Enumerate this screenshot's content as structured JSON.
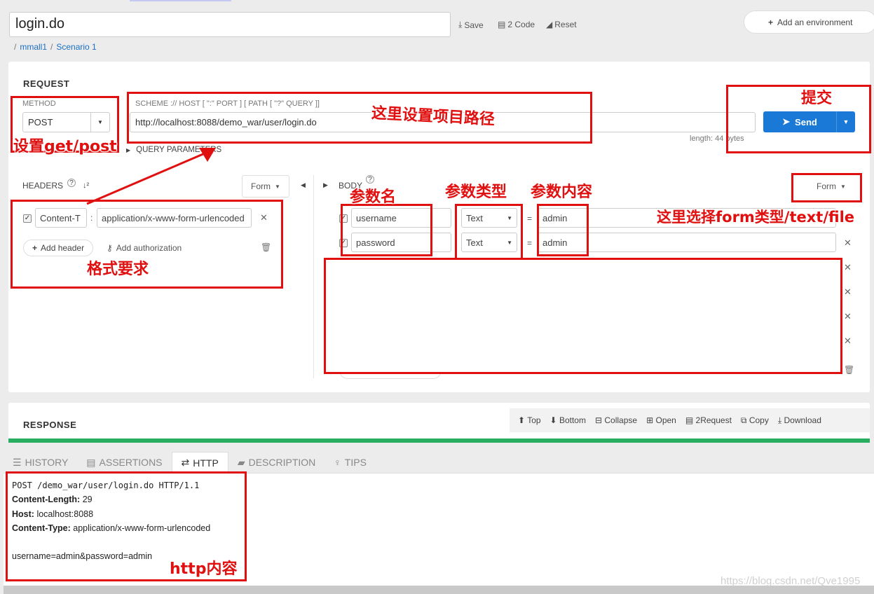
{
  "title": "login.do",
  "toolbar": {
    "save": "Save",
    "code": "2 Code",
    "reset": "Reset",
    "add_env": "Add an environment"
  },
  "breadcrumbs": [
    "mmall1",
    "Scenario 1"
  ],
  "request": {
    "heading": "REQUEST",
    "method_label": "METHOD",
    "method_value": "POST",
    "scheme_hint": "SCHEME :// HOST [ \":\" PORT ] [ PATH [ \"?\" QUERY ]]",
    "url": "http://localhost:8088/demo_war/user/login.do",
    "length": "length: 44 bytes",
    "query_params": "QUERY PARAMETERS",
    "send": "Send"
  },
  "headers": {
    "label": "HEADERS",
    "mode": "Form",
    "row": {
      "name": "Content-T",
      "value": "application/x-www-form-urlencoded"
    },
    "add_header": "Add header",
    "add_auth": "Add authorization"
  },
  "body": {
    "label": "BODY",
    "mode": "Form",
    "params": [
      {
        "name": "username",
        "type": "Text",
        "value": "admin"
      },
      {
        "name": "password",
        "type": "Text",
        "value": "admin"
      }
    ]
  },
  "response": {
    "heading": "RESPONSE",
    "tools": [
      "Top",
      "Bottom",
      "Collapse",
      "Open",
      "2Request",
      "Copy",
      "Download"
    ]
  },
  "tabs": [
    "HISTORY",
    "ASSERTIONS",
    "HTTP",
    "DESCRIPTION",
    "TIPS"
  ],
  "active_tab": "HTTP",
  "http": {
    "request_line": "POST /demo_war/user/login.do HTTP/1.1",
    "headers": [
      {
        "key": "Content-Length:",
        "value": "29"
      },
      {
        "key": "Host:",
        "value": "localhost:8088"
      },
      {
        "key": "Content-Type:",
        "value": "application/x-www-form-urlencoded"
      }
    ],
    "body": "username=admin&password=admin"
  },
  "annotations": {
    "submit": "提交",
    "path": "这里设置项目路径",
    "method": "设置get/post",
    "format": "格式要求",
    "param_name": "参数名",
    "param_type": "参数类型",
    "param_value": "参数内容",
    "form_type": "这里选择form类型/text/file",
    "http_content": "http内容"
  },
  "watermark": "https://blog.csdn.net/Qve1995",
  "colors": {
    "accent": "#1a78d6",
    "annotation": "#e01010",
    "progress": "#27ae60"
  }
}
